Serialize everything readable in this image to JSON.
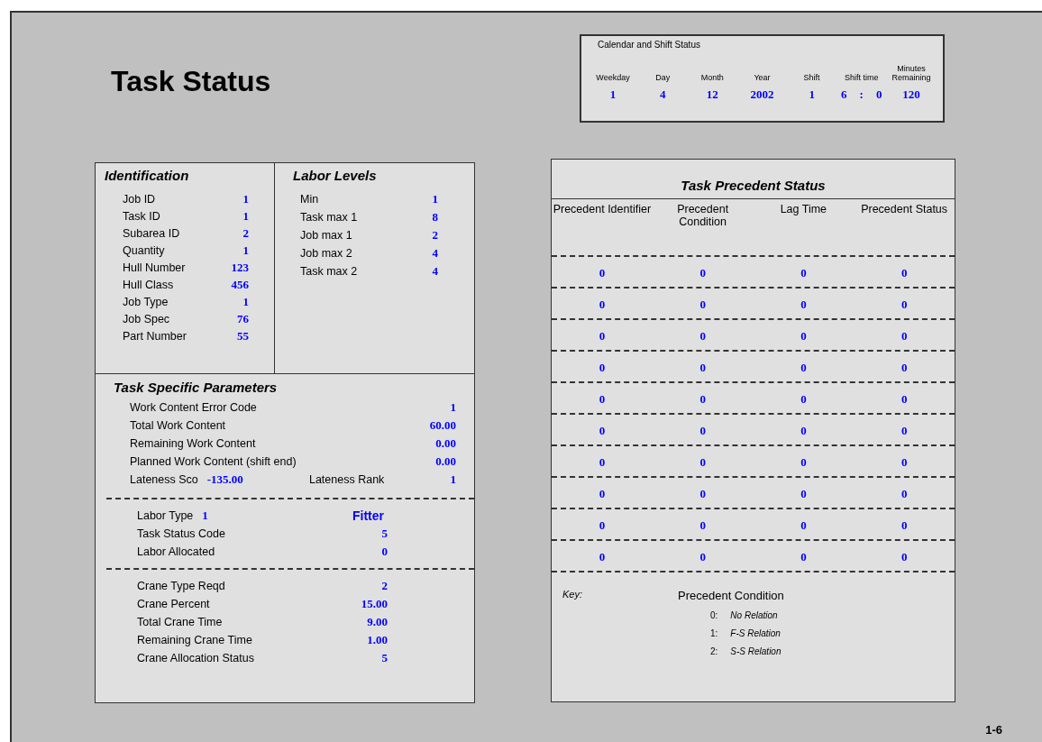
{
  "title": "Task Status",
  "calendar": {
    "title": "Calendar and Shift Status",
    "columns": [
      {
        "label": "Weekday",
        "values": [
          "1"
        ]
      },
      {
        "label": "Day",
        "values": [
          "4"
        ]
      },
      {
        "label": "Month",
        "values": [
          "12"
        ]
      },
      {
        "label": "Year",
        "values": [
          "2002"
        ]
      },
      {
        "label": "Shift",
        "values": [
          "1"
        ]
      },
      {
        "label": "Shift time",
        "values": [
          "6",
          ":",
          "0"
        ]
      },
      {
        "label": "Minutes Remaining",
        "values": [
          "120"
        ]
      }
    ]
  },
  "identification": {
    "title": "Identification",
    "fields": [
      {
        "label": "Job ID",
        "value": "1"
      },
      {
        "label": "Task ID",
        "value": "1"
      },
      {
        "label": "Subarea ID",
        "value": "2"
      },
      {
        "label": "Quantity",
        "value": "1"
      },
      {
        "label": "Hull Number",
        "value": "123"
      },
      {
        "label": "Hull Class",
        "value": "456"
      },
      {
        "label": "Job Type",
        "value": "1"
      },
      {
        "label": "Job Spec",
        "value": "76"
      },
      {
        "label": "Part Number",
        "value": "55"
      }
    ]
  },
  "labor_levels": {
    "title": "Labor Levels",
    "fields": [
      {
        "label": "Min",
        "value": "1"
      },
      {
        "label": "Task max 1",
        "value": "8"
      },
      {
        "label": "Job max 1",
        "value": "2"
      },
      {
        "label": "Job max 2",
        "value": "4"
      },
      {
        "label": "Task max 2",
        "value": "4"
      }
    ]
  },
  "task_parameters": {
    "title": "Task  Specific Parameters",
    "groups": [
      [
        {
          "label": "Work Content Error Code",
          "value": "1"
        },
        {
          "label": "Total Work Content",
          "value": "60.00"
        },
        {
          "label": "Remaining Work Content",
          "value": "0.00"
        },
        {
          "label": "Planned Work Content (shift end)",
          "value": "0.00"
        },
        {
          "label": "Lateness Sco",
          "value": "-135.00",
          "label_2": "Lateness Rank",
          "value_2": "1"
        }
      ],
      [
        {
          "label": "Labor Type",
          "value": "1",
          "note": "Fitter"
        },
        {
          "label": "Task Status Code",
          "value": "5"
        },
        {
          "label": "Labor Allocated",
          "value": "0"
        }
      ],
      [
        {
          "label": "Crane Type Reqd",
          "value": "2"
        },
        {
          "label": "Crane Percent",
          "value": "15.00"
        },
        {
          "label": "Total Crane Time",
          "value": "9.00"
        },
        {
          "label": "Remaining Crane Time",
          "value": "1.00"
        },
        {
          "label": "Crane Allocation Status",
          "value": "5"
        }
      ]
    ]
  },
  "precedents": {
    "title": "Task Precedent Status",
    "columns": [
      "Precedent Identifier",
      "Precedent Condition",
      "Lag Time",
      "Precedent Status"
    ],
    "rows": [
      [
        "0",
        "0",
        "0",
        "0"
      ],
      [
        "0",
        "0",
        "0",
        "0"
      ],
      [
        "0",
        "0",
        "0",
        "0"
      ],
      [
        "0",
        "0",
        "0",
        "0"
      ],
      [
        "0",
        "0",
        "0",
        "0"
      ],
      [
        "0",
        "0",
        "0",
        "0"
      ],
      [
        "0",
        "0",
        "0",
        "0"
      ],
      [
        "0",
        "0",
        "0",
        "0"
      ],
      [
        "0",
        "0",
        "0",
        "0"
      ],
      [
        "0",
        "0",
        "0",
        "0"
      ]
    ],
    "key": {
      "label": "Key:",
      "heading": "Precedent Condition",
      "entries": [
        {
          "code": "0:",
          "text": "No Relation"
        },
        {
          "code": "1:",
          "text": "F-S Relation"
        },
        {
          "code": "2:",
          "text": "S-S Relation"
        }
      ]
    }
  },
  "page_number": "1-6"
}
